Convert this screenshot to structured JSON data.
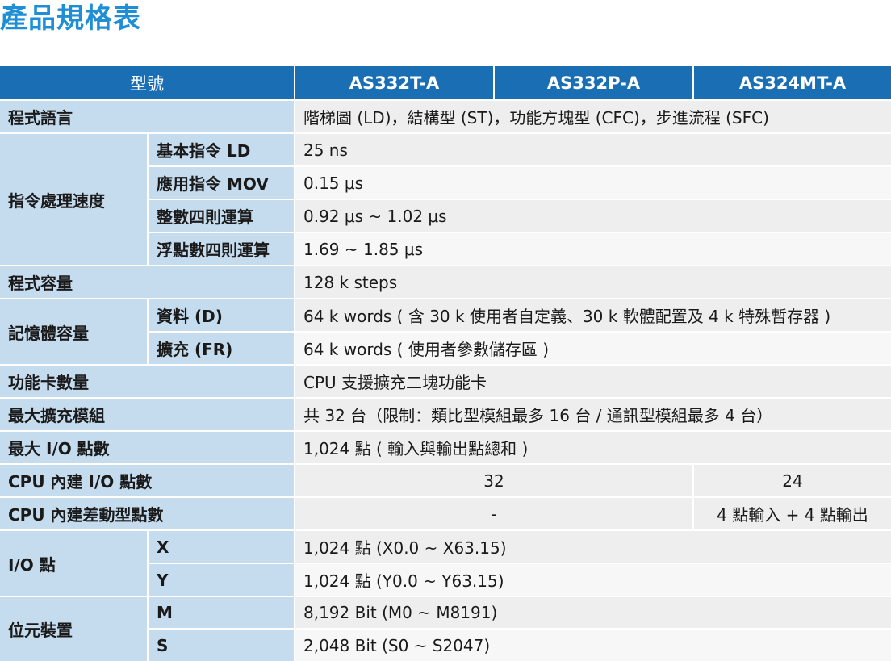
{
  "page_title": "產品規格表",
  "header": {
    "model_label": "型號",
    "models": [
      "AS332T-A",
      "AS332P-A",
      "AS324MT-A"
    ]
  },
  "rows": {
    "program_language": {
      "label": "程式語言",
      "value": "階梯圖 (LD)，結構型 (ST)，功能方塊型 (CFC)，步進流程 (SFC)"
    },
    "instruction_speed": {
      "label": "指令處理速度",
      "items": [
        {
          "label": "基本指令 LD",
          "value": "25 ns"
        },
        {
          "label": "應用指令 MOV",
          "value": "0.15 μs"
        },
        {
          "label": "整數四則運算",
          "value": "0.92 μs ~ 1.02 μs"
        },
        {
          "label": "浮點數四則運算",
          "value": "1.69 ~ 1.85 μs"
        }
      ]
    },
    "program_capacity": {
      "label": "程式容量",
      "value": "128 k steps"
    },
    "memory_capacity": {
      "label": "記憶體容量",
      "items": [
        {
          "label": "資料 (D)",
          "value": "64 k words ( 含 30 k 使用者自定義、30 k 軟體配置及 4 k 特殊暫存器 )"
        },
        {
          "label": "擴充 (FR)",
          "value": "64 k words ( 使用者參數儲存區 )"
        }
      ]
    },
    "function_cards": {
      "label": "功能卡數量",
      "value": "CPU 支援擴充二塊功能卡"
    },
    "max_modules": {
      "label": "最大擴充模組",
      "value": "共 32 台（限制：類比型模組最多 16 台 / 通訊型模組最多 4 台）"
    },
    "max_io": {
      "label": "最大 I/O 點數",
      "value": "1,024 點 ( 輸入與輸出點總和 )"
    },
    "cpu_io": {
      "label": "CPU 內建 I/O 點數",
      "value_ab": "32",
      "value_c": "24"
    },
    "cpu_diff": {
      "label": "CPU 內建差動型點數",
      "value_ab": "-",
      "value_c": "4 點輸入 + 4 點輸出"
    },
    "io_points": {
      "label": "I/O 點",
      "items": [
        {
          "label": "X",
          "value": "1,024 點 (X0.0 ~ X63.15)"
        },
        {
          "label": "Y",
          "value": "1,024 點 (Y0.0 ~ Y63.15)"
        }
      ]
    },
    "bit_devices": {
      "label": "位元裝置",
      "items": [
        {
          "label": "M",
          "value": "8,192 Bit (M0 ~ M8191)"
        },
        {
          "label": "S",
          "value": "2,048 Bit (S0 ~ S2047)"
        }
      ]
    }
  }
}
